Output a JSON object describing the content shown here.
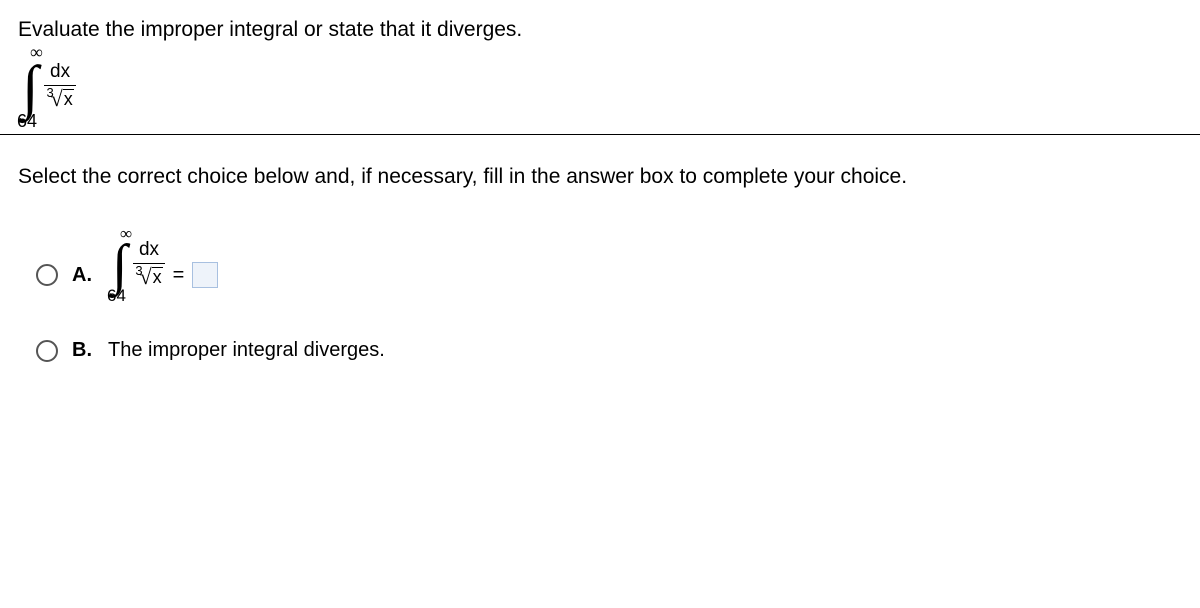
{
  "question": "Evaluate the improper integral or state that it diverges.",
  "integral": {
    "upper_limit": "∞",
    "lower_limit": "64",
    "numerator": "dx",
    "root_index": "3",
    "radicand": "x"
  },
  "instruction": "Select the correct choice below and, if necessary, fill in the answer box to complete your choice.",
  "choices": {
    "a": {
      "label": "A.",
      "integral": {
        "upper_limit": "∞",
        "lower_limit": "64",
        "numerator": "dx",
        "root_index": "3",
        "radicand": "x"
      },
      "equals": "="
    },
    "b": {
      "label": "B.",
      "text": "The improper integral diverges."
    }
  }
}
